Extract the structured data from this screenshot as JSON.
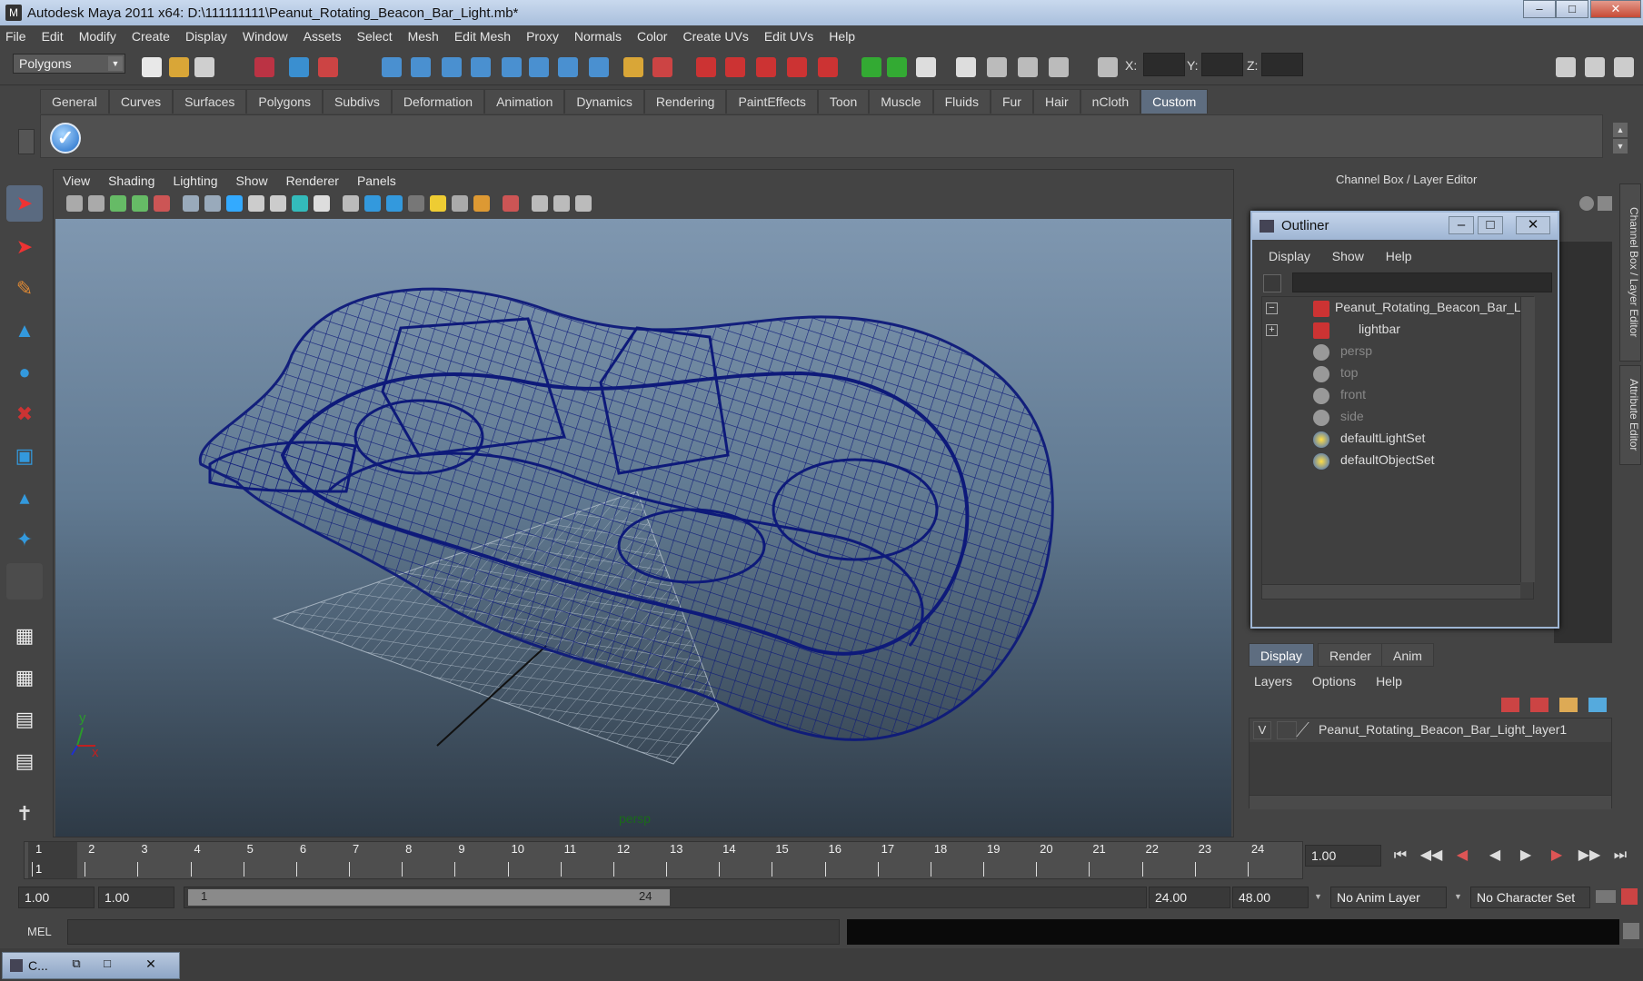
{
  "window": {
    "title": "Autodesk Maya 2011 x64: D:\\111111111\\Peanut_Rotating_Beacon_Bar_Light.mb*",
    "minimize": "–",
    "maximize": "□",
    "close": "✕"
  },
  "menubar": [
    "File",
    "Edit",
    "Modify",
    "Create",
    "Display",
    "Window",
    "Assets",
    "Select",
    "Mesh",
    "Edit Mesh",
    "Proxy",
    "Normals",
    "Color",
    "Create UVs",
    "Edit UVs",
    "Help"
  ],
  "status": {
    "mode": "Polygons",
    "x_label": "X:",
    "y_label": "Y:",
    "z_label": "Z:"
  },
  "shelf": {
    "tabs": [
      "General",
      "Curves",
      "Surfaces",
      "Polygons",
      "Subdivs",
      "Deformation",
      "Animation",
      "Dynamics",
      "Rendering",
      "PaintEffects",
      "Toon",
      "Muscle",
      "Fluids",
      "Fur",
      "Hair",
      "nCloth",
      "Custom"
    ],
    "active_tab": "Custom"
  },
  "viewport": {
    "menu": [
      "View",
      "Shading",
      "Lighting",
      "Show",
      "Renderer",
      "Panels"
    ],
    "camera_label": "persp",
    "axis_y": "y",
    "axis_x": "x",
    "wire_color": "#0e1a7a"
  },
  "channel_box": {
    "title": "Channel Box / Layer Editor",
    "side_tab_1": "Channel Box / Layer Editor",
    "side_tab_2": "Attribute Editor"
  },
  "outliner": {
    "title": "Outliner",
    "menu": [
      "Display",
      "Show",
      "Help"
    ],
    "items": [
      {
        "label": "Peanut_Rotating_Beacon_Bar_Ligl",
        "dim": false,
        "expand": "−"
      },
      {
        "label": "lightbar",
        "dim": false,
        "expand": "+"
      },
      {
        "label": "persp",
        "dim": true
      },
      {
        "label": "top",
        "dim": true
      },
      {
        "label": "front",
        "dim": true
      },
      {
        "label": "side",
        "dim": true
      },
      {
        "label": "defaultLightSet",
        "dim": false
      },
      {
        "label": "defaultObjectSet",
        "dim": false
      }
    ]
  },
  "layer_editor": {
    "tabs": [
      "Display",
      "Render",
      "Anim"
    ],
    "active_tab": "Display",
    "menu": [
      "Layers",
      "Options",
      "Help"
    ],
    "layer_visible": "V",
    "layer_name": "Peanut_Rotating_Beacon_Bar_Light_layer1"
  },
  "time_slider": {
    "ticks": [
      "1",
      "2",
      "3",
      "4",
      "5",
      "6",
      "7",
      "8",
      "9",
      "10",
      "11",
      "12",
      "13",
      "14",
      "15",
      "16",
      "17",
      "18",
      "19",
      "20",
      "21",
      "22",
      "23",
      "24"
    ],
    "current_frame": "1",
    "current_time": "1.00"
  },
  "range_slider": {
    "start_time": "1.00",
    "playback_start": "1.00",
    "range_start": "1",
    "range_end": "24",
    "playback_end": "24.00",
    "end_time": "48.00",
    "anim_layer": "No Anim Layer",
    "character_set": "No Character Set"
  },
  "command_line": {
    "label": "MEL"
  },
  "taskbar": {
    "item_label": "C..."
  }
}
